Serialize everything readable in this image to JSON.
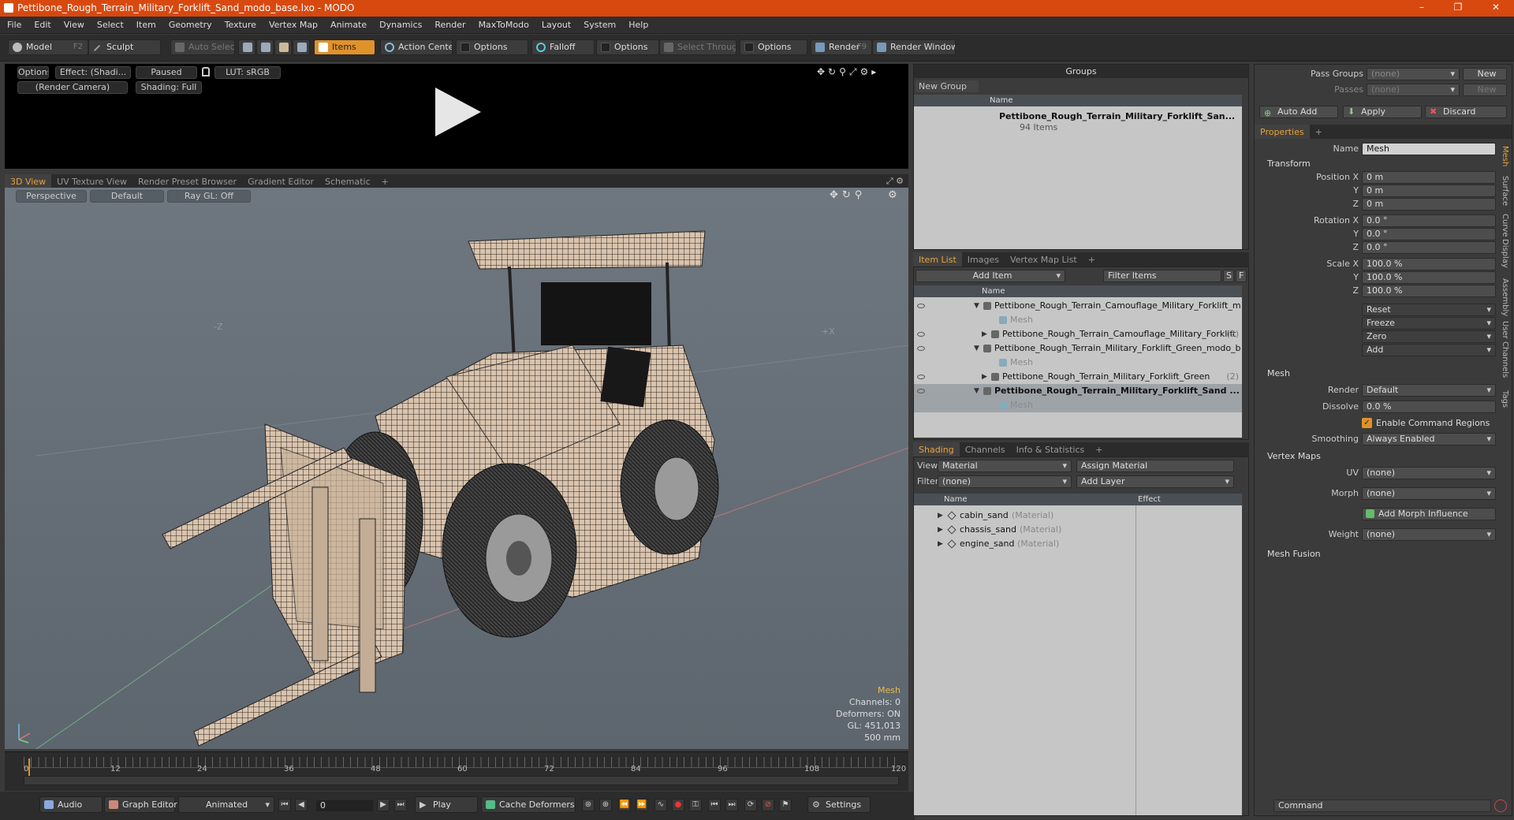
{
  "window": {
    "title": "Pettibone_Rough_Terrain_Military_Forklift_Sand_modo_base.lxo - MODO",
    "controls": [
      "–",
      "❐",
      "✕"
    ]
  },
  "menu": [
    "File",
    "Edit",
    "View",
    "Select",
    "Item",
    "Geometry",
    "Texture",
    "Vertex Map",
    "Animate",
    "Dynamics",
    "Render",
    "MaxToModo",
    "Layout",
    "System",
    "Help"
  ],
  "toolbar": {
    "model": "Model",
    "model_key": "F2",
    "sculpt": "Sculpt",
    "auto_select": "Auto Select",
    "items": "Items",
    "action_center": "Action Center",
    "options1": "Options",
    "falloff": "Falloff",
    "options2": "Options",
    "select_through": "Select Through",
    "options3": "Options",
    "render": "Render",
    "render_key": "F9",
    "render_window": "Render Window"
  },
  "preview": {
    "options": "Options",
    "effect": "Effect: (Shadi...",
    "paused": "Paused",
    "lut": "LUT: sRGB",
    "camera": "(Render Camera)",
    "shading": "Shading: Full"
  },
  "viewport_tabs": [
    "3D View",
    "UV Texture View",
    "Render Preset Browser",
    "Gradient Editor",
    "Schematic",
    "+"
  ],
  "viewport": {
    "perspective": "Perspective",
    "default": "Default",
    "raygl": "Ray GL: Off",
    "axis_neg_z": "-Z",
    "axis_pos_x": "+X",
    "hud_title": "Mesh",
    "hud_lines": [
      "Channels: 0",
      "Deformers: ON",
      "GL: 451,013",
      "500 mm"
    ]
  },
  "timeline": {
    "ticks": [
      "0",
      "12",
      "24",
      "36",
      "48",
      "60",
      "72",
      "84",
      "96",
      "108",
      "120"
    ],
    "sub_mid": "120",
    "sub_end": "120"
  },
  "bottom": {
    "audio": "Audio",
    "graph_editor": "Graph Editor",
    "animated": "Animated",
    "frame": "0",
    "play": "Play",
    "cache_deformers": "Cache Deformers",
    "settings": "Settings"
  },
  "groups": {
    "title": "Groups",
    "new_group": "New Group",
    "col_name": "Name",
    "item_name": "Pettibone_Rough_Terrain_Military_Forklift_San...",
    "item_count": "94 Items"
  },
  "item_list": {
    "tabs": [
      "Item List",
      "Images",
      "Vertex Map List",
      "+"
    ],
    "add_item": "Add Item",
    "filter": "Filter Items",
    "btn_s": "S",
    "btn_f": "F",
    "col_name": "Name",
    "rows": [
      {
        "text": "Pettibone_Rough_Terrain_Camouflage_Military_Forklift_m ...",
        "indent": 0,
        "bold": false,
        "dim": false
      },
      {
        "text": "Mesh",
        "indent": 2,
        "bold": false,
        "dim": true
      },
      {
        "text": "Pettibone_Rough_Terrain_Camouflage_Military_Forklift",
        "suffix": "(2)",
        "indent": 1,
        "bold": false,
        "dim": false
      },
      {
        "text": "Pettibone_Rough_Terrain_Military_Forklift_Green_modo_b ...",
        "indent": 0,
        "bold": false,
        "dim": false
      },
      {
        "text": "Mesh",
        "indent": 2,
        "bold": false,
        "dim": true
      },
      {
        "text": "Pettibone_Rough_Terrain_Military_Forklift_Green",
        "suffix": "(2)",
        "indent": 1,
        "bold": false,
        "dim": false
      },
      {
        "text": "Pettibone_Rough_Terrain_Military_Forklift_Sand ...",
        "indent": 0,
        "bold": true,
        "dim": false
      },
      {
        "text": "Mesh",
        "indent": 2,
        "bold": false,
        "dim": true
      }
    ]
  },
  "shading": {
    "tabs": [
      "Shading",
      "Channels",
      "Info & Statistics",
      "+"
    ],
    "view_label": "View",
    "view_value": "Material",
    "assign_material": "Assign Material",
    "filter_label": "Filter",
    "filter_value": "(none)",
    "add_layer": "Add Layer",
    "col_name": "Name",
    "col_effect": "Effect",
    "rows": [
      {
        "name": "cabin_sand",
        "type": "(Material)"
      },
      {
        "name": "chassis_sand",
        "type": "(Material)"
      },
      {
        "name": "engine_sand",
        "type": "(Material)"
      }
    ]
  },
  "right_top": {
    "pass_groups": "Pass Groups",
    "pass_groups_value": "(none)",
    "passes": "Passes",
    "passes_value": "(none)",
    "new1": "New",
    "new2": "New",
    "auto_add": "Auto Add",
    "apply": "Apply",
    "discard": "Discard"
  },
  "properties": {
    "tab": "Properties",
    "name_label": "Name",
    "name_value": "Mesh",
    "transform": "Transform",
    "position_label": "Position X",
    "rotation_label": "Rotation X",
    "scale_label": "Scale X",
    "y": "Y",
    "z": "Z",
    "position": [
      "0 m",
      "0 m",
      "0 m"
    ],
    "rotation": [
      "0.0 °",
      "0.0 °",
      "0.0 °"
    ],
    "scale": [
      "100.0 %",
      "100.0 %",
      "100.0 %"
    ],
    "reset": "Reset",
    "freeze": "Freeze",
    "zero": "Zero",
    "add": "Add",
    "mesh": "Mesh",
    "render_label": "Render",
    "render_value": "Default",
    "dissolve_label": "Dissolve",
    "dissolve_value": "0.0 %",
    "enable_cmd_regions": "Enable Command Regions",
    "smoothing_label": "Smoothing",
    "smoothing_value": "Always Enabled",
    "vertex_maps": "Vertex Maps",
    "uv_label": "UV",
    "uv_value": "(none)",
    "morph_label": "Morph",
    "morph_value": "(none)",
    "add_morph": "Add Morph Influence",
    "weight_label": "Weight",
    "weight_value": "(none)",
    "mesh_fusion": "Mesh Fusion",
    "side_tabs": [
      "Mesh",
      "Surface",
      "Curve",
      "Display",
      "Assembly",
      "User Channels",
      "Tags"
    ]
  },
  "command": {
    "placeholder": "Command"
  },
  "colors": {
    "title_bar": "#d8490f",
    "accent": "#e0922a",
    "viewport_bg": "#67707a"
  }
}
